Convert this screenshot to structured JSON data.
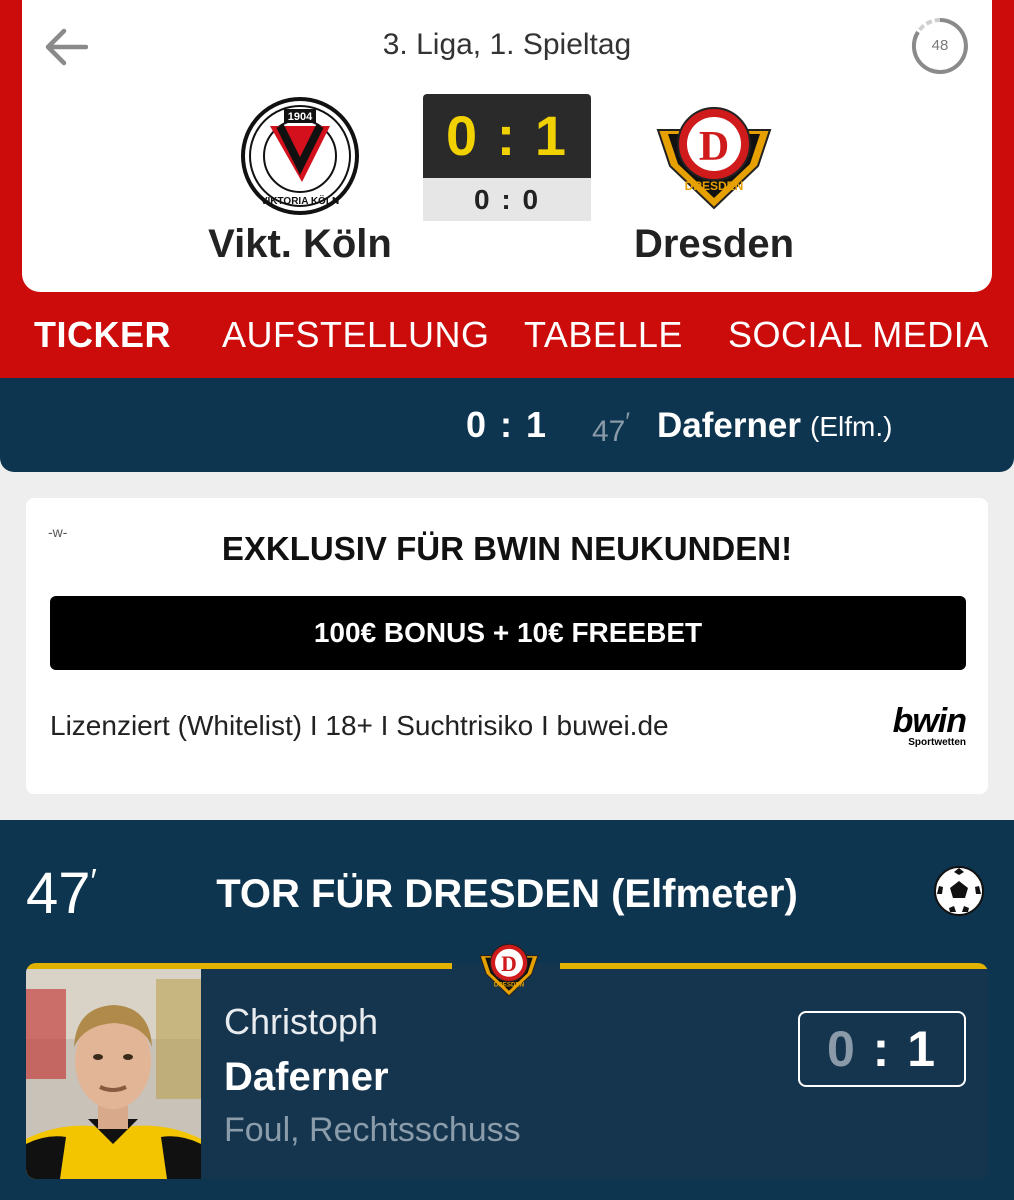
{
  "header": {
    "league": "3. Liga, 1. Spieltag",
    "minute_badge": "48",
    "home_team": {
      "name": "Vikt. Köln",
      "crest_year": "1904",
      "crest_text": "VIKTORIA KÖLN"
    },
    "away_team": {
      "name": "Dresden",
      "crest_letter": "D",
      "crest_text": "DRESDEN"
    },
    "score": "0 : 1",
    "halftime_score": "0 : 0"
  },
  "tabs": [
    {
      "label": "TICKER",
      "active": true
    },
    {
      "label": "AUFSTELLUNG",
      "active": false
    },
    {
      "label": "TABELLE",
      "active": false
    },
    {
      "label": "SOCIAL MEDIA",
      "active": false
    }
  ],
  "goal_strip": {
    "score": "0 : 1",
    "minute": "47",
    "player": "Daferner",
    "note": "(Elfm.)"
  },
  "ad": {
    "mark": "-w-",
    "title": "EXKLUSIV FÜR BWIN NEUKUNDEN!",
    "button": "100€ BONUS + 10€ FREEBET",
    "legal": "Lizenziert (Whitelist) I 18+ I Suchtrisiko I buwei.de",
    "brand": "bwin",
    "brand_sub": "Sportwetten"
  },
  "event": {
    "minute": "47",
    "title": "TOR FÜR DRESDEN (Elfmeter)",
    "first_name": "Christoph",
    "last_name": "Daferner",
    "description": "Foul, Rechtsschuss",
    "score_home": "0",
    "score_sep": ":",
    "score_away": "1"
  },
  "colors": {
    "brand_red": "#cc0b0b",
    "navy": "#0d3550",
    "score_yellow": "#f1d100",
    "gold": "#e2b200"
  },
  "icons": [
    "back-arrow-icon",
    "minute-ring-icon",
    "football-icon",
    "viktoria-koeln-crest",
    "dynamo-dresden-crest",
    "player-photo"
  ]
}
